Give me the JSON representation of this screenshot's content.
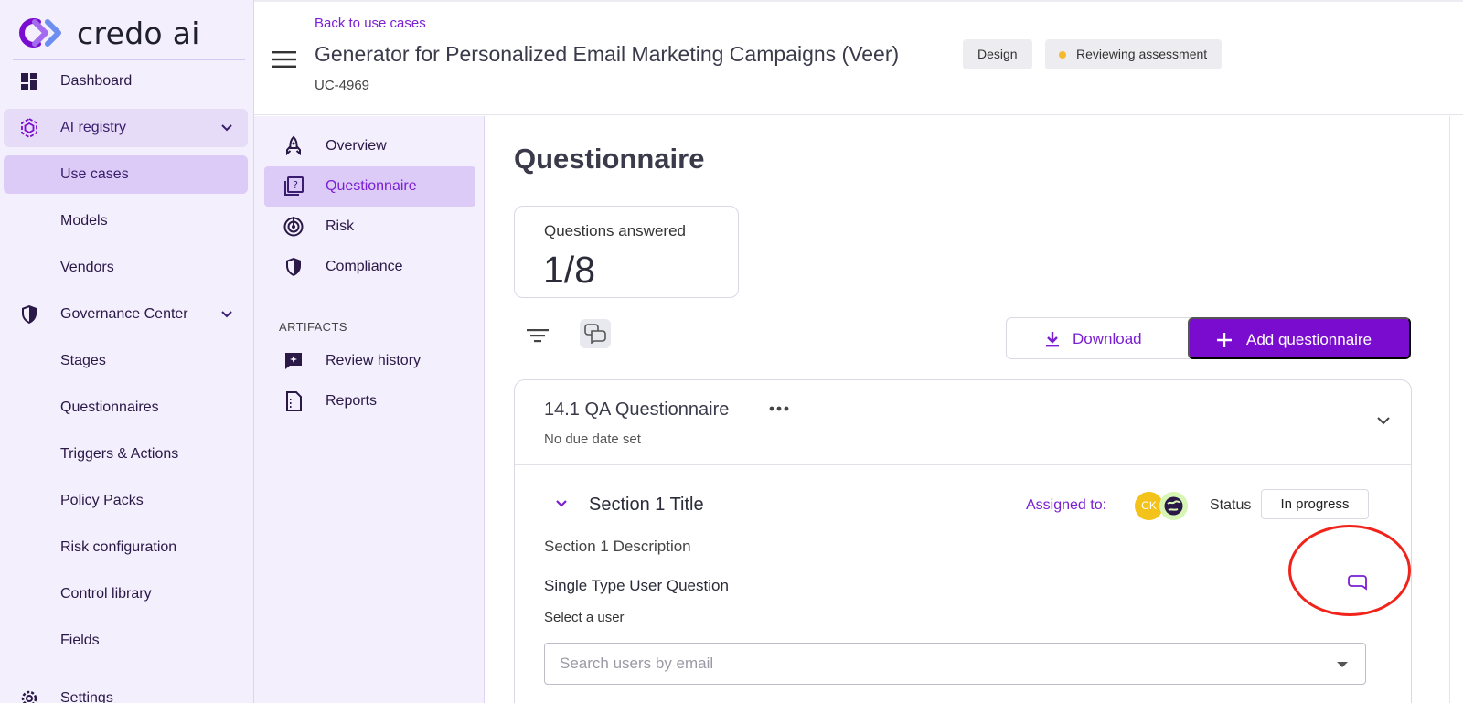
{
  "brand": {
    "name": "credo ai",
    "accent": "#7a0ccf",
    "sidebar_bg": "#f3effd"
  },
  "sidebar": {
    "items": [
      {
        "label": "Dashboard",
        "icon": "dashboard-icon"
      },
      {
        "label": "AI registry",
        "icon": "ai-registry-icon",
        "expanded": true
      },
      {
        "label": "Use cases",
        "selected": true
      },
      {
        "label": "Models"
      },
      {
        "label": "Vendors"
      },
      {
        "label": "Governance Center",
        "icon": "shield-icon",
        "expanded": true
      },
      {
        "label": "Stages"
      },
      {
        "label": "Questionnaires"
      },
      {
        "label": "Triggers & Actions"
      },
      {
        "label": "Policy Packs"
      },
      {
        "label": "Risk configuration"
      },
      {
        "label": "Control library"
      },
      {
        "label": "Fields"
      },
      {
        "label": "Settings",
        "icon": "gear-icon"
      }
    ]
  },
  "header": {
    "back_link": "Back to use cases",
    "title": "Generator for Personalized Email Marketing Campaigns (Veer)",
    "stage_badge": "Design",
    "status_badge": "Reviewing assessment",
    "status_color": "#f5b92b",
    "id": "UC-4969"
  },
  "subnav": {
    "items": [
      {
        "label": "Overview",
        "icon": "rocket-icon"
      },
      {
        "label": "Questionnaire",
        "icon": "questionnaire-icon",
        "selected": true
      },
      {
        "label": "Risk",
        "icon": "target-icon"
      },
      {
        "label": "Compliance",
        "icon": "shield-icon"
      }
    ],
    "artifacts_heading": "ARTIFACTS",
    "artifacts": [
      {
        "label": "Review history",
        "icon": "review-history-icon"
      },
      {
        "label": "Reports",
        "icon": "reports-icon"
      }
    ]
  },
  "main": {
    "heading": "Questionnaire",
    "stat": {
      "label": "Questions answered",
      "value": "1/8"
    },
    "download_label": "Download",
    "add_label": "Add questionnaire",
    "questionnaire": {
      "title": "14.1 QA Questionnaire",
      "due": "No due date set",
      "section": {
        "title": "Section 1 Title",
        "assigned_label": "Assigned to:",
        "avatar_initials": "CK",
        "status_label": "Status",
        "status_value": "In progress",
        "description": "Section 1 Description",
        "question": "Single Type User Question",
        "select_label": "Select a user",
        "search_placeholder": "Search users by email"
      }
    }
  }
}
